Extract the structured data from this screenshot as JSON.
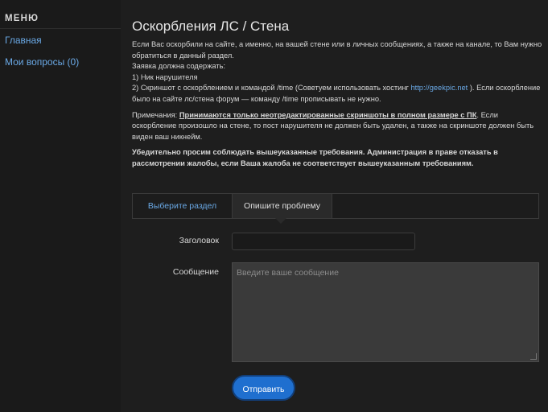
{
  "sidebar": {
    "title": "МЕНЮ",
    "items": [
      {
        "label": "Главная"
      },
      {
        "label": "Мои вопросы (0)"
      }
    ]
  },
  "page": {
    "title": "Оскорбления ЛС / Стена",
    "intro": "Если Вас оскорбили на сайте, а именно, на вашей стене или в личных сообщениях, а также на канале, то Вам нужно обратиться в данный раздел.",
    "request_heading": "Заявка должна содержать:",
    "item1": "1) Ник нарушителя",
    "item2_pre": "2) Скриншот с оскорблением и командой /time (Советуем использовать хостинг ",
    "item2_link": "http://geekpic.net",
    "item2_post": " ). Если оскорбление было на сайте лс/стена форум — команду /time прописывать не нужно.",
    "note_label": "Примечания: ",
    "note_emph": "Принимаются только неотредактированные скриншоты в полном размере с ПК",
    "note_rest": ". Если оскорбление произошло на стене, то пост нарушителя не должен быть удален, а также на скриншоте должен быть виден ваш никнейм.",
    "warning": "Убедительно просим соблюдать вышеуказанные требования. Администрация в праве отказать в рассмотрении жалобы, если Ваша жалоба не соответствует вышеуказанным требованиям."
  },
  "tabs": [
    {
      "label": "Выберите раздел"
    },
    {
      "label": "Опишите проблему"
    }
  ],
  "form": {
    "title_label": "Заголовок",
    "title_value": "",
    "message_label": "Сообщение",
    "message_placeholder": "Введите ваше сообщение",
    "submit_label": "Отправить"
  },
  "colors": {
    "background": "#1e1e1e",
    "link": "#6aa9e6",
    "accent": "#1f6fcf"
  }
}
